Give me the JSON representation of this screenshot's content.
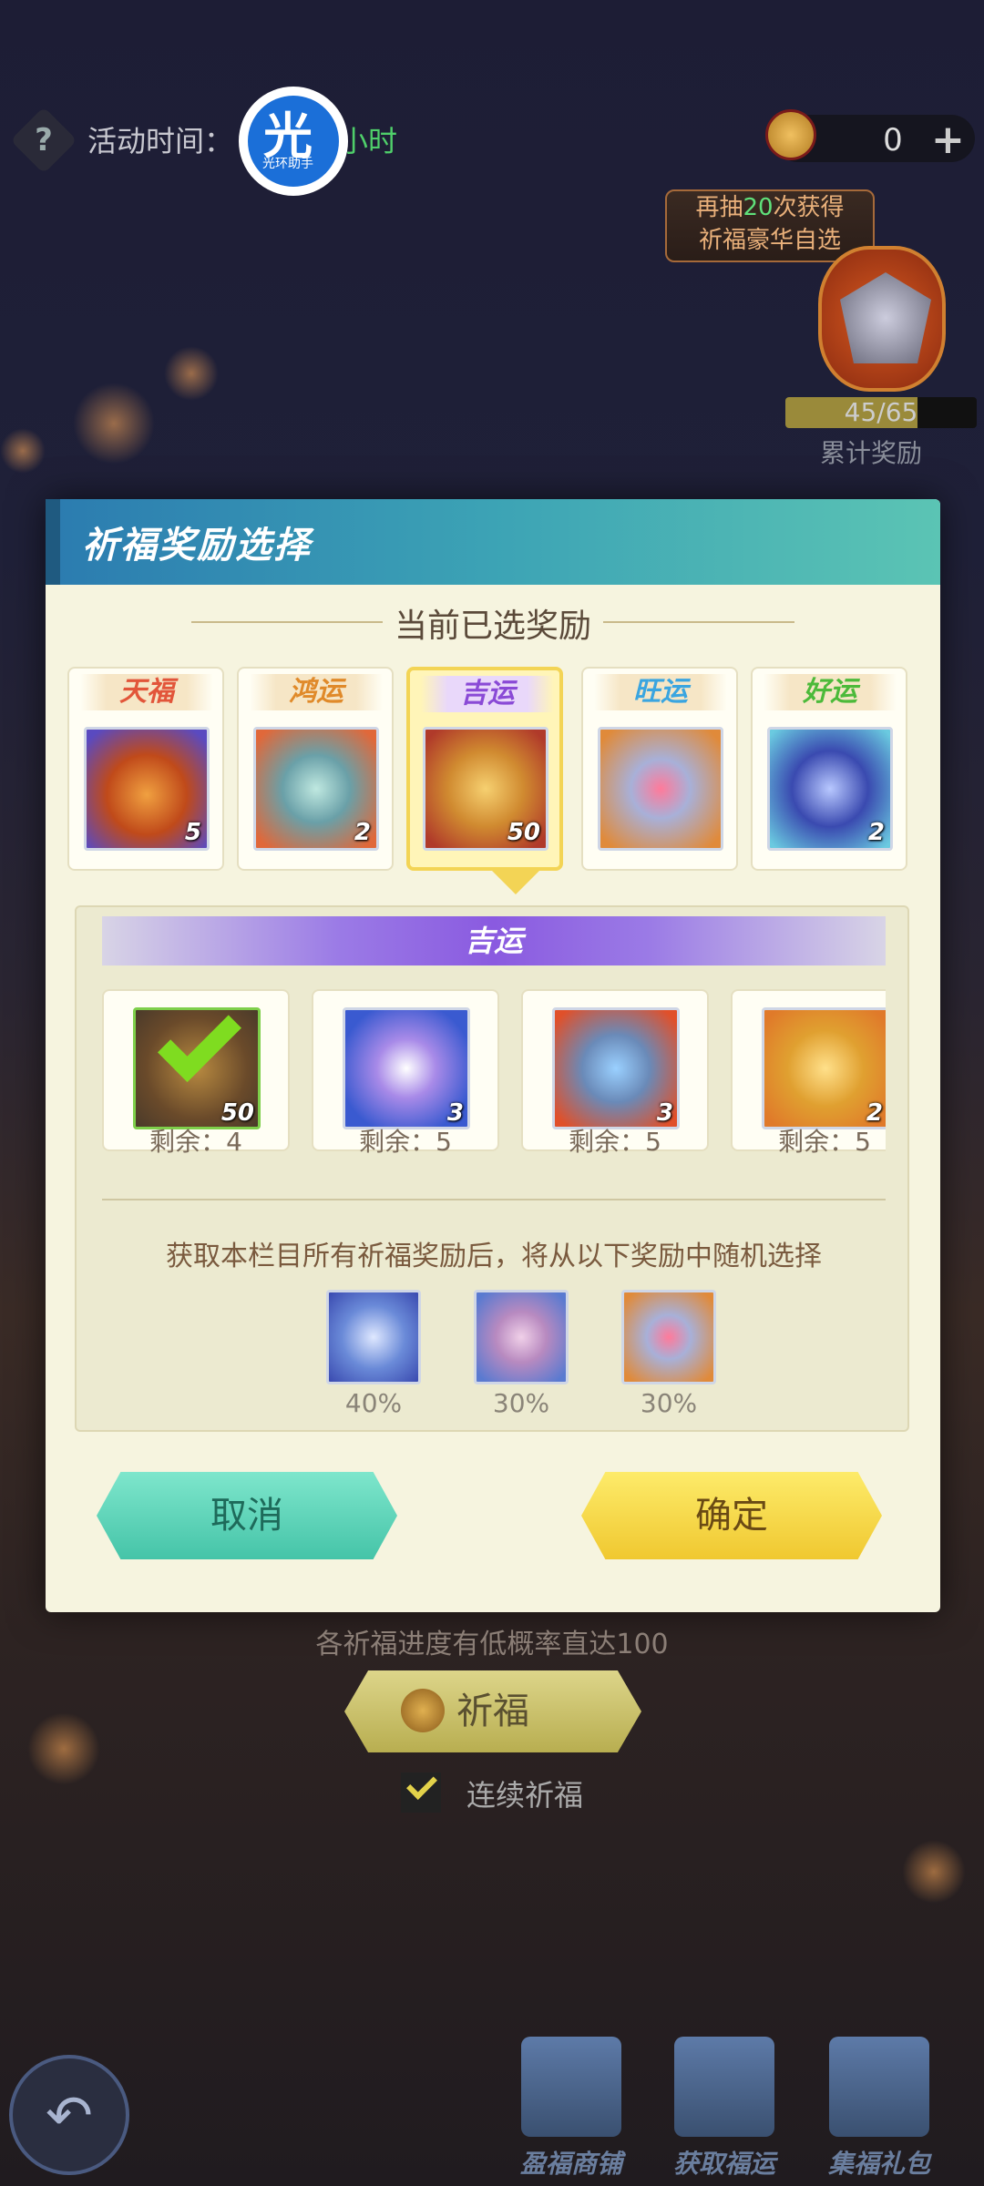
{
  "top": {
    "time_label": "活动时间：",
    "time_value": "小时",
    "logo_glyph": "光",
    "logo_caption": "光环助手",
    "currency_amount": "0",
    "promo_prefix": "再抽",
    "promo_count": "20",
    "promo_suffix": "次获得",
    "promo_line2": "祈福豪华自选",
    "progress_text": "45/65",
    "progress_fraction": 0.692,
    "cumulative_label": "累计奖励"
  },
  "modal": {
    "title": "祈福奖励选择",
    "section_title": "当前已选奖励",
    "categories": [
      {
        "name": "天福",
        "count": "5",
        "color": "#e2553a"
      },
      {
        "name": "鸿运",
        "count": "2",
        "color": "#e08a2a"
      },
      {
        "name": "吉运",
        "count": "50",
        "color": "#8a4ad6"
      },
      {
        "name": "旺运",
        "count": "",
        "color": "#3aa5e0"
      },
      {
        "name": "好运",
        "count": "2",
        "color": "#4cba3a"
      }
    ],
    "selected_category": "吉运",
    "pool_items": [
      {
        "count": "50",
        "remaining": "剩余：4",
        "claimed": true
      },
      {
        "count": "3",
        "remaining": "剩余：5",
        "claimed": false
      },
      {
        "count": "3",
        "remaining": "剩余：5",
        "claimed": false
      },
      {
        "count": "2",
        "remaining": "剩余：5",
        "claimed": false
      }
    ],
    "pool_description": "获取本栏目所有祈福奖励后，将从以下奖励中随机选择",
    "random_rewards": [
      {
        "percent": "40%"
      },
      {
        "percent": "30%"
      },
      {
        "percent": "30%"
      }
    ],
    "cancel_label": "取消",
    "confirm_label": "确定"
  },
  "bottom": {
    "hint": "各祈福进度有低概率直达100",
    "pray_label": "祈福",
    "continuous_label": "连续祈福",
    "nav": [
      "盈福商铺",
      "获取福运",
      "集福礼包"
    ]
  }
}
